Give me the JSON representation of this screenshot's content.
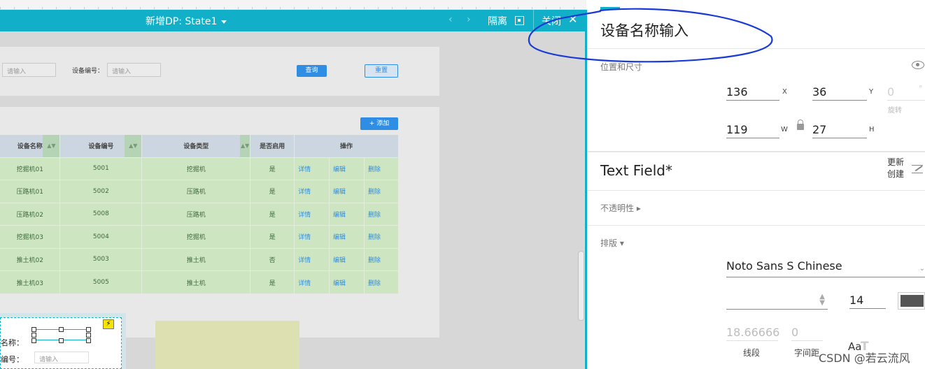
{
  "topbar": {
    "title": "新增DP: State1",
    "isolate_label": "隔离",
    "close_label": "关闭",
    "prev_glyph": "‹",
    "next_glyph": "›",
    "close_glyph": "✕"
  },
  "search_form": {
    "first_input_placeholder": "请输入",
    "device_no_label": "设备编号：",
    "device_no_placeholder": "请输入",
    "query_button": "查询",
    "reset_button": "重置"
  },
  "table": {
    "add_button": "+ 添加",
    "columns": [
      "设备名称",
      "设备编号",
      "设备类型",
      "是否启用",
      "操作"
    ],
    "sort_glyph": "▲▼",
    "rows": [
      {
        "name": "挖掘机01",
        "code": "5001",
        "type": "挖掘机",
        "enabled": "是"
      },
      {
        "name": "压路机01",
        "code": "5002",
        "type": "压路机",
        "enabled": "是"
      },
      {
        "name": "压路机02",
        "code": "5008",
        "type": "压路机",
        "enabled": "是"
      },
      {
        "name": "挖掘机03",
        "code": "5004",
        "type": "挖掘机",
        "enabled": "是"
      },
      {
        "name": "推土机02",
        "code": "5003",
        "type": "推土机",
        "enabled": "否"
      },
      {
        "name": "推土机03",
        "code": "5005",
        "type": "推土机",
        "enabled": "是"
      }
    ],
    "actions": [
      "详情",
      "编辑",
      "删除"
    ]
  },
  "mini_form": {
    "name_label": "名称：",
    "code_label": "编号：",
    "input_placeholder": "请输入",
    "bolt_glyph": "⚡"
  },
  "inspector": {
    "title": "设备名称输入",
    "position_size_label": "位置和尺寸",
    "x_value": "136",
    "x_axis": "X",
    "y_value": "36",
    "y_axis": "Y",
    "rotation_value": "0",
    "rotation_unit": "°",
    "rotation_label": "旋转",
    "w_value": "119",
    "w_axis": "W",
    "h_value": "27",
    "h_axis": "H",
    "widget_type": "Text Field*",
    "update_label_line1": "更新",
    "update_label_line2": "创建",
    "opacity_label": "不透明性 ▸",
    "typography_label": "排版 ▾",
    "font_family_value": "Noto Sans S Chinese",
    "font_size_value": "14",
    "text_color": "#555555",
    "line_height_value": "18.66666",
    "line_height_label": "线段",
    "letter_spacing_value": "0",
    "letter_spacing_label": "字间距",
    "aa_glyph": "Aa",
    "t_glyph": "T"
  },
  "watermark": "CSDN @若云流风",
  "colors": {
    "accent_teal": "#12b0c8",
    "button_blue": "#2f8de4",
    "row_green": "#cde5c0",
    "annotation_blue": "#1a3ad6"
  }
}
